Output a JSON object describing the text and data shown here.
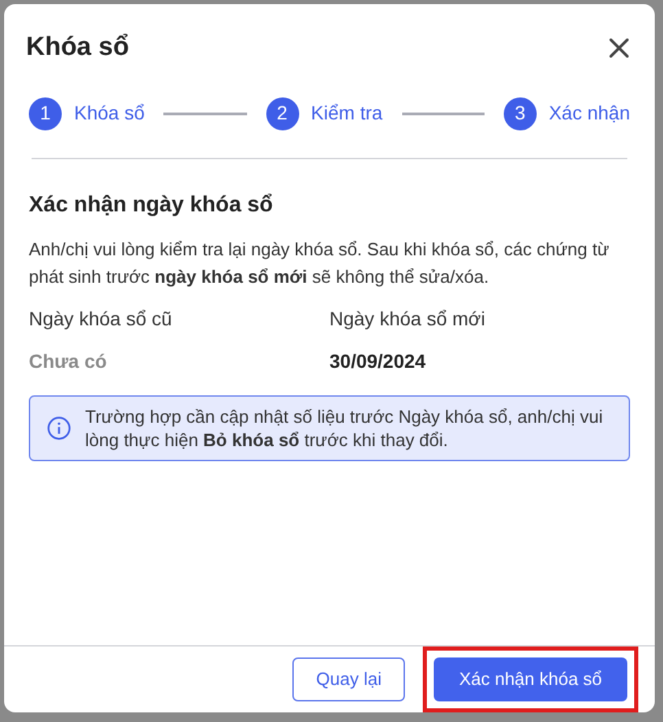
{
  "dialog": {
    "title": "Khóa sổ"
  },
  "steps": [
    {
      "number": "1",
      "label": "Khóa sổ"
    },
    {
      "number": "2",
      "label": "Kiểm tra"
    },
    {
      "number": "3",
      "label": "Xác nhận"
    }
  ],
  "section": {
    "heading": "Xác nhận ngày khóa sổ",
    "description": "Anh/chị vui lòng kiểm tra lại ngày khóa sổ. Sau khi khóa sổ, các chứng từ phát sinh trước **ngày khóa sổ mới** sẽ không thể sửa/xóa."
  },
  "fields": [
    {
      "label": "Ngày khóa sổ cũ",
      "value": "Chưa có",
      "kind": "empty"
    },
    {
      "label": "Ngày khóa sổ mới",
      "value": "30/09/2024",
      "kind": "date"
    }
  ],
  "notice": {
    "text": "Trường hợp cần cập nhật số liệu trước Ngày khóa sổ, anh/chị vui lòng thực hiện **Bỏ khóa sổ** trước khi thay đổi."
  },
  "buttons": [
    {
      "label": "Quay lại",
      "kind": "secondary",
      "highlighted": false
    },
    {
      "label": "Xác nhận khóa sổ",
      "kind": "primary",
      "highlighted": true
    }
  ]
}
